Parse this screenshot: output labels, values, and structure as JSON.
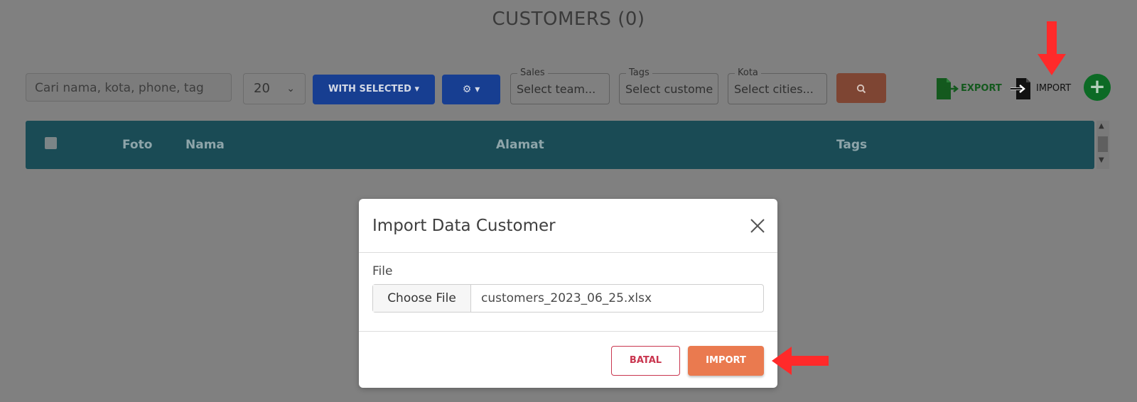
{
  "page": {
    "title": "CUSTOMERS (0)"
  },
  "toolbar": {
    "search_placeholder": "Cari nama, kota, phone, tag",
    "per_page": "20",
    "with_selected_label": "WITH SELECTED ▾",
    "settings_label": "⚙ ▾",
    "sales": {
      "legend": "Sales",
      "value": "Select team..."
    },
    "tags": {
      "legend": "Tags",
      "value": "Select custome"
    },
    "kota": {
      "legend": "Kota",
      "value": "Select cities..."
    },
    "export_label": "EXPORT",
    "import_label": "IMPORT",
    "add_label": "+"
  },
  "table": {
    "columns": [
      "Foto",
      "Nama",
      "Alamat",
      "Tags"
    ]
  },
  "modal": {
    "title": "Import Data Customer",
    "file_label": "File",
    "choose_file_label": "Choose File",
    "file_name": "customers_2023_06_25.xlsx",
    "cancel_label": "BATAL",
    "import_label": "IMPORT"
  },
  "colors": {
    "overlay": "#808080",
    "table_header": "#1a4b55",
    "import_accent": "#ea7a4f",
    "cancel_accent": "#c9364f",
    "annotation_arrow": "#ff2a2a"
  }
}
